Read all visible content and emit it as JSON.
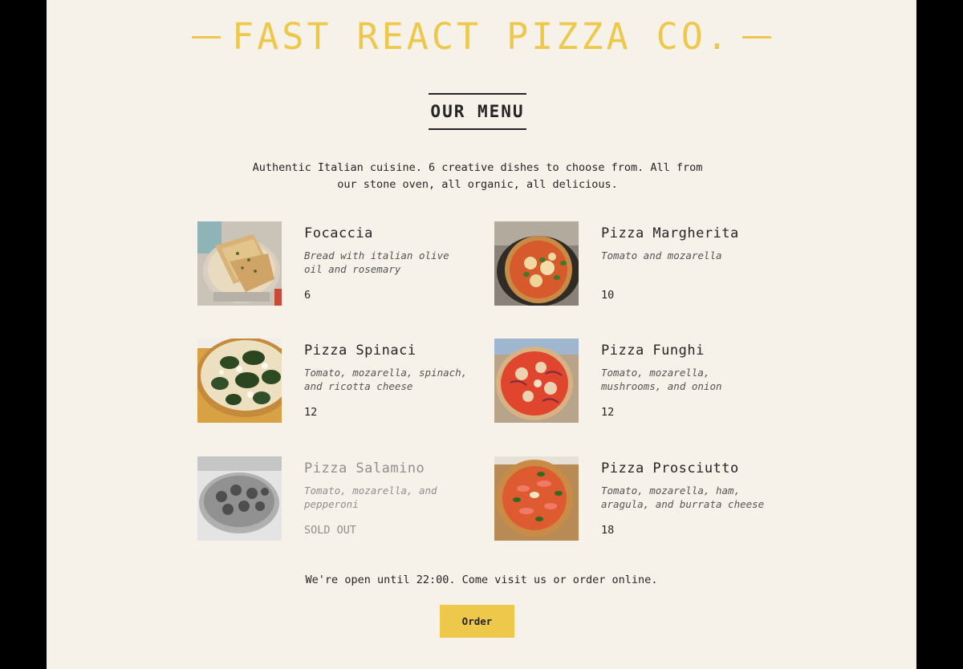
{
  "header": {
    "title": "FAST REACT PIZZA CO."
  },
  "menu": {
    "heading": "OUR MENU",
    "intro": "Authentic Italian cuisine. 6 creative dishes to choose from. All from our stone oven, all organic, all delicious.",
    "pizzas": [
      {
        "name": "Focaccia",
        "ingredients": "Bread with italian olive oil and rosemary",
        "price": "6",
        "sold_out": false,
        "image_icon": "focaccia-photo"
      },
      {
        "name": "Pizza Margherita",
        "ingredients": "Tomato and mozarella",
        "price": "10",
        "sold_out": false,
        "image_icon": "pizza-margherita-photo"
      },
      {
        "name": "Pizza Spinaci",
        "ingredients": "Tomato, mozarella, spinach, and ricotta cheese",
        "price": "12",
        "sold_out": false,
        "image_icon": "pizza-spinaci-photo"
      },
      {
        "name": "Pizza Funghi",
        "ingredients": "Tomato, mozarella, mushrooms, and onion",
        "price": "12",
        "sold_out": false,
        "image_icon": "pizza-funghi-photo"
      },
      {
        "name": "Pizza Salamino",
        "ingredients": "Tomato, mozarella, and pepperoni",
        "price": "SOLD OUT",
        "sold_out": true,
        "image_icon": "pizza-salamino-photo"
      },
      {
        "name": "Pizza Prosciutto",
        "ingredients": "Tomato, mozarella, ham, aragula, and burrata cheese",
        "price": "18",
        "sold_out": false,
        "image_icon": "pizza-prosciutto-photo"
      }
    ]
  },
  "footer": {
    "text": "We're open until 22:00. Come visit us or order online.",
    "order_label": "Order"
  },
  "colors": {
    "accent": "#edc84b",
    "background": "#f6f2e9",
    "text": "#252525",
    "sold_out_text": "#8f8f8f"
  }
}
